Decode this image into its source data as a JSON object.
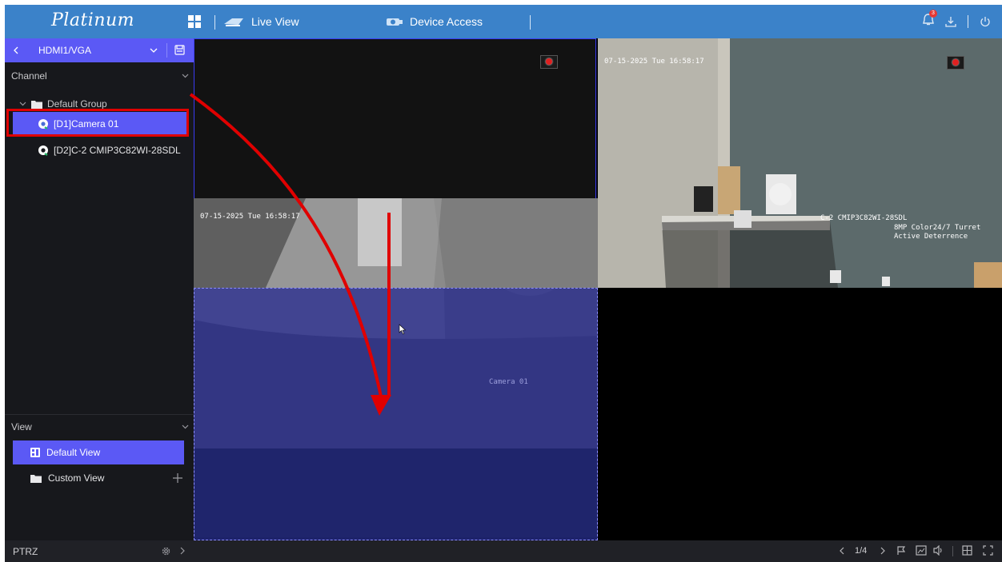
{
  "app": {
    "logo": "Platinum"
  },
  "topbar": {
    "tabs": [
      {
        "label": "Live View"
      },
      {
        "label": "Device Access"
      }
    ],
    "notification_count": "3"
  },
  "sidebar": {
    "display_output": "HDMI1/VGA",
    "channel_header": "Channel",
    "group": "Default Group",
    "channels": [
      {
        "label": "[D1]Camera 01"
      },
      {
        "label": "[D2]C-2 CMIP3C82WI-28SDL"
      }
    ],
    "view_header": "View",
    "views": [
      {
        "label": "Default View"
      },
      {
        "label": "Custom View"
      }
    ]
  },
  "bottombar": {
    "ptrz_label": "PTRZ",
    "page": "1/4"
  },
  "tiles": {
    "tile2": {
      "timestamp": "07-15-2025 Tue 16:58:17",
      "camera_name": "C-2 CMIP3C82WI-28SDL",
      "desc_line1": "8MP Color24/7 Turret",
      "desc_line2": "Active Deterrence"
    },
    "tile3": {
      "timestamp": "07-15-2025 Tue 16:58:17",
      "camera_name": "Camera 01"
    }
  },
  "colors": {
    "accent": "#5b59f5",
    "topbar": "#3b82c9",
    "highlight_box": "#e00000",
    "drop_zone": "#2e3292"
  }
}
